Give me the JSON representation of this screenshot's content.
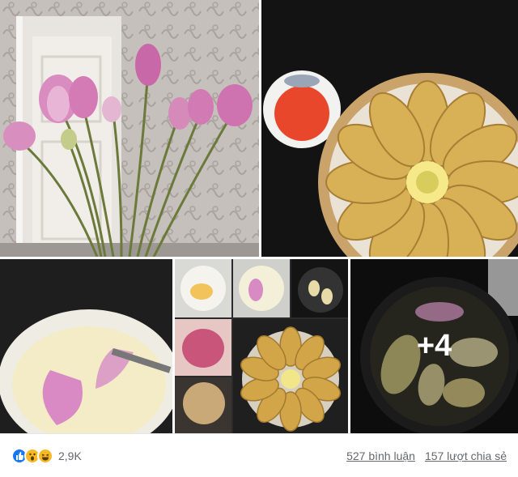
{
  "photos": [
    {
      "icon": "lotus-buds-vase-photo"
    },
    {
      "icon": "fried-lotus-petals-plate-photo"
    },
    {
      "icon": "lotus-petal-batter-bowl-photo"
    },
    {
      "icon": "cooking-collage-photo"
    },
    {
      "icon": "frying-pan-photo"
    }
  ],
  "more_photos": "+4",
  "reactions": {
    "icons": [
      "like-icon",
      "wow-icon",
      "haha-icon"
    ],
    "count": "2,9K"
  },
  "comments": "527 bình luận",
  "shares": "157 lượt chia sẻ",
  "colors": {
    "like": "#1877f2",
    "emoji": "#f7b928",
    "text_muted": "#65676b"
  }
}
